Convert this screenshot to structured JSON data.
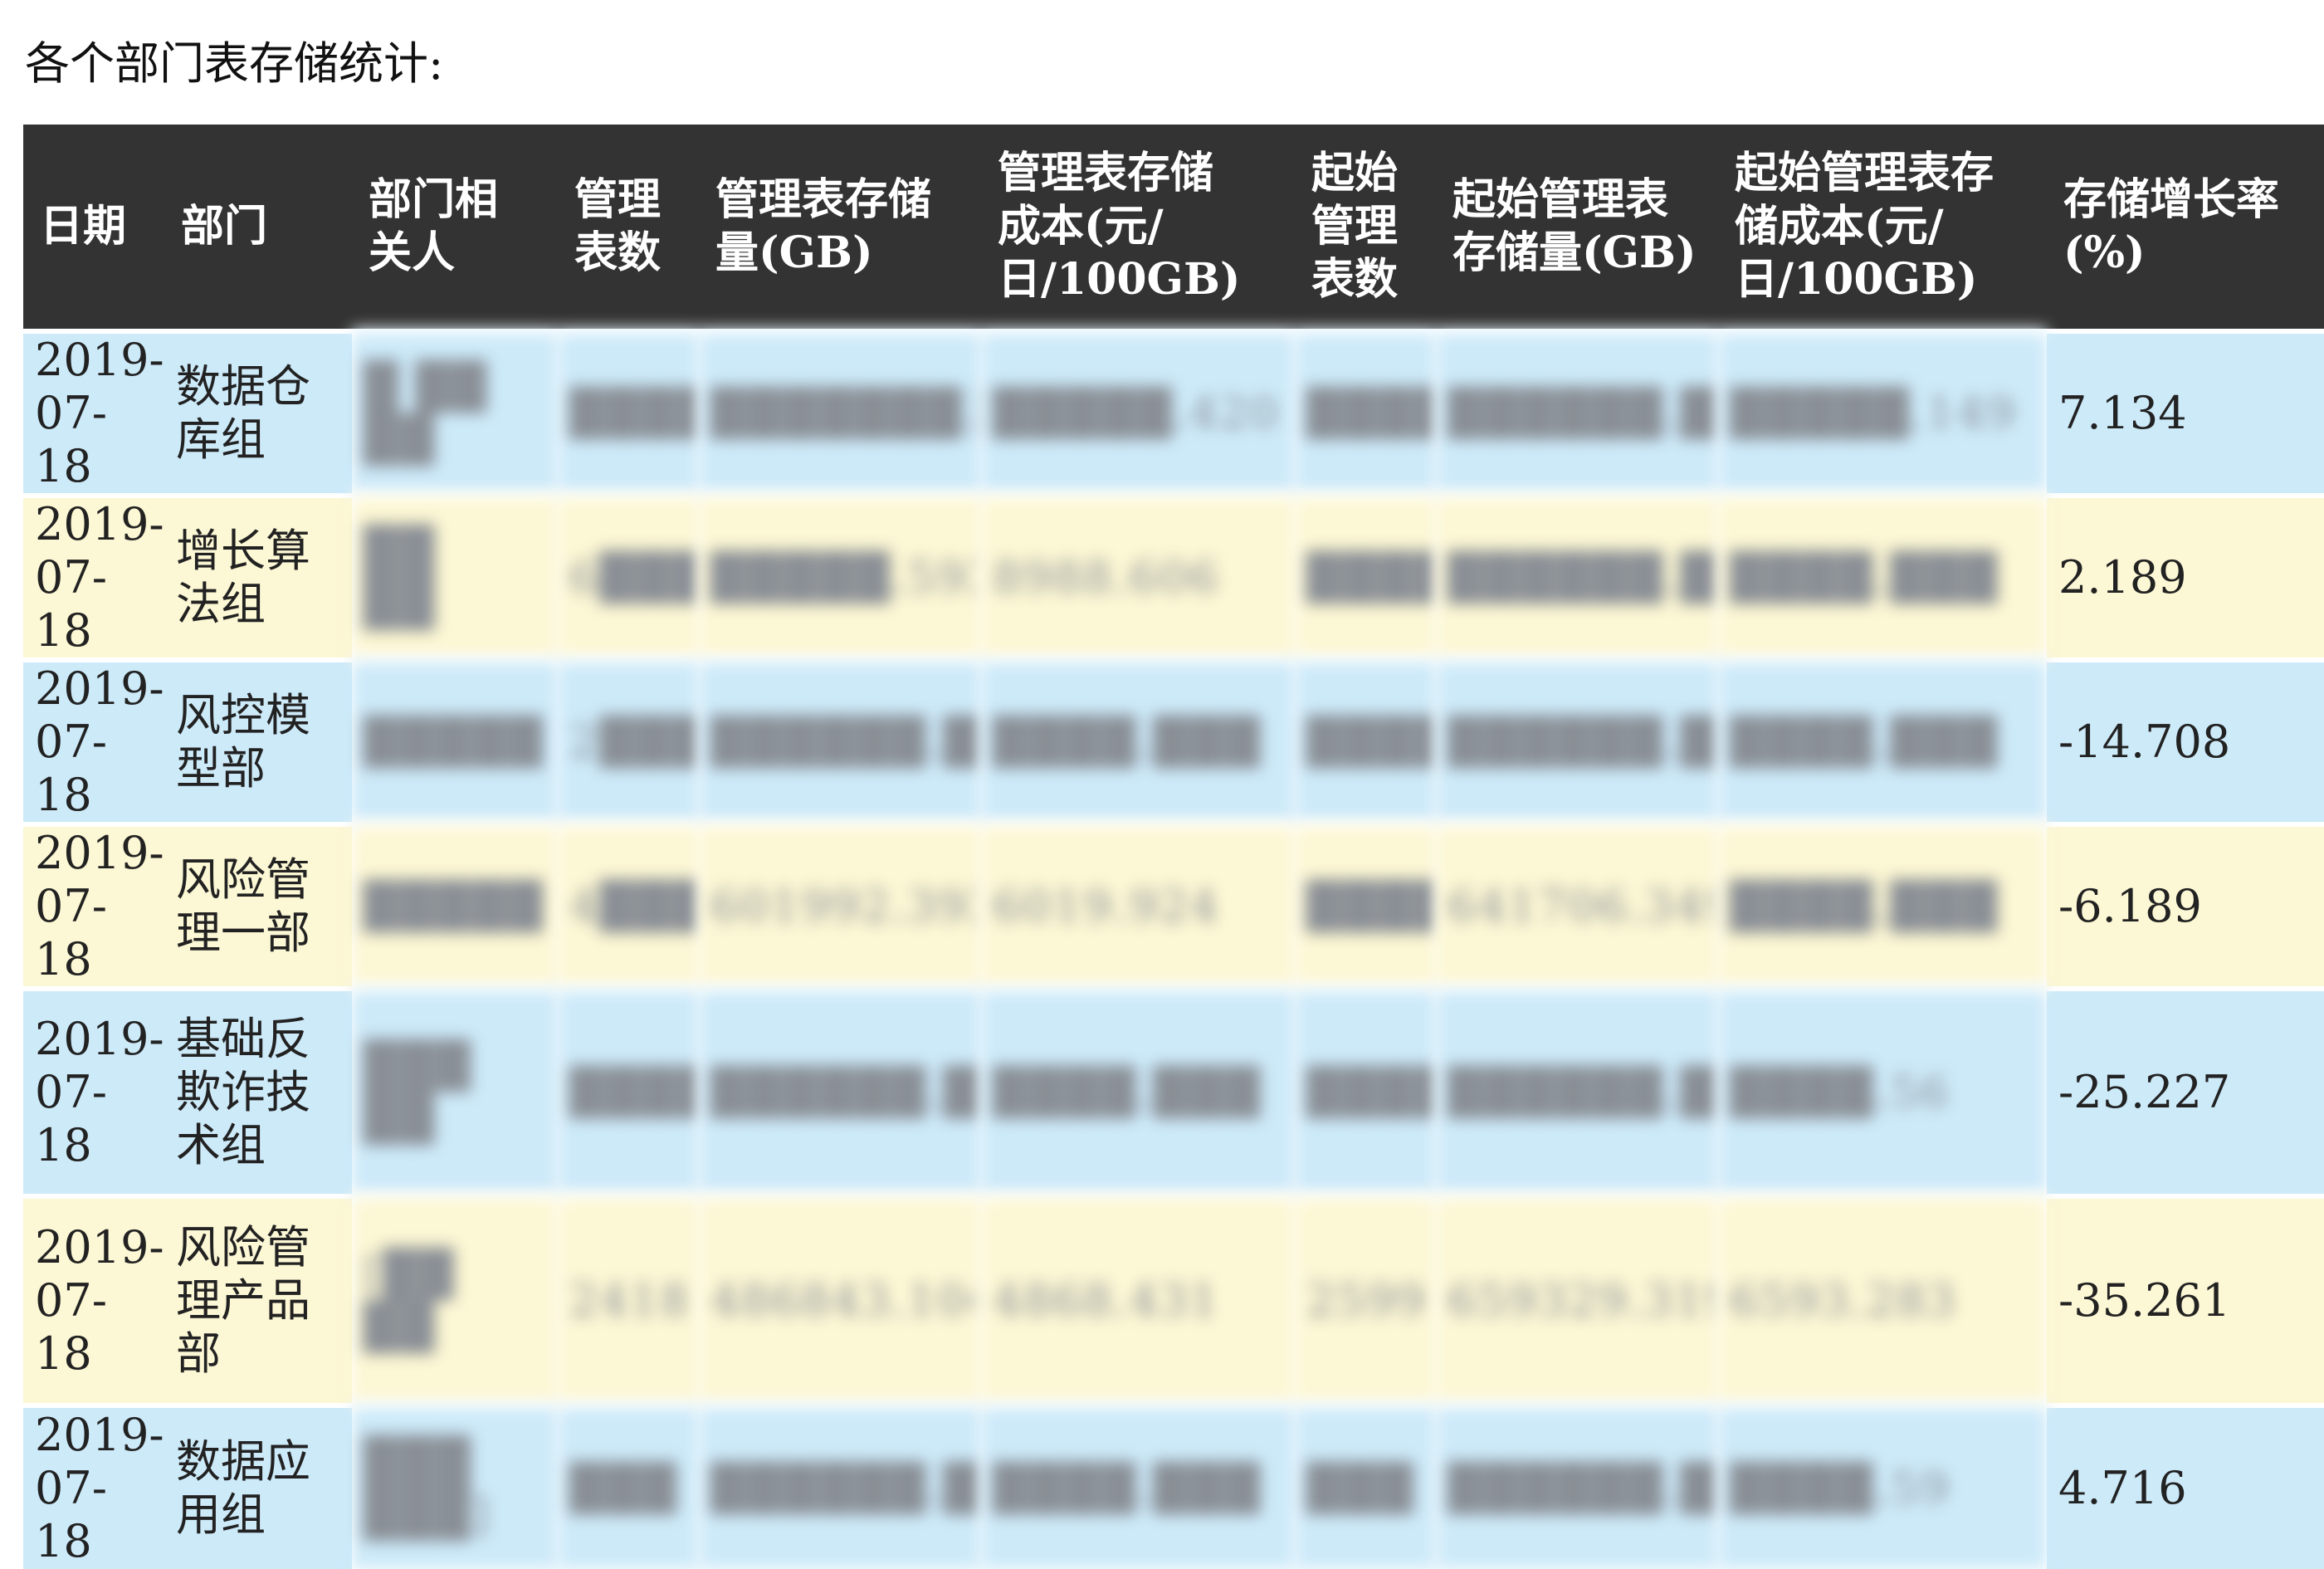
{
  "caption": "各个部门表存储统计:",
  "table": {
    "headers": [
      "日期",
      "部门",
      "部门相\n关人",
      "管理\n表数",
      "管理表存储\n量(GB)",
      "管理表存储\n成本(元/\n日/100GB)",
      "起始\n管理\n表数",
      "起始管理表\n存储量(GB)",
      "起始管理表存\n储成本(元/\n日/100GB)",
      "存储增长率\n(%)"
    ],
    "rows": [
      {
        "date": "2019-\n07-18",
        "dept": "数据仓\n库组",
        "person": "█ ██\n██",
        "tables": "████",
        "storage": "███████.███",
        "cost": "█████.420",
        "start_tables": "████",
        "start_storage": "██████.███",
        "start_cost": "█████.149",
        "growth": "7.134"
      },
      {
        "date": "2019-\n07-18",
        "dept": "增长算\n法组",
        "person": "██\n██",
        "tables": "6███",
        "storage": "█████.593",
        "cost": "8988.606",
        "start_tables": "████",
        "start_storage": "██████.███",
        "start_cost": "████.███",
        "growth": "2.189"
      },
      {
        "date": "2019-\n07-18",
        "dept": "风控模\n型部",
        "person": "█████",
        "tables": "2███",
        "storage": "██████.███",
        "cost": "████.███",
        "start_tables": "████",
        "start_storage": "██████.███",
        "start_cost": "████.███",
        "growth": "-14.708"
      },
      {
        "date": "2019-\n07-18",
        "dept": "风险管\n理一部",
        "person": "█████",
        "tables": "4███",
        "storage": "601992.393",
        "cost": "6019.924",
        "start_tables": "████",
        "start_storage": "641706.349",
        "start_cost": "████.███",
        "growth": "-6.189"
      },
      {
        "date": "2019-\n07-18",
        "dept": "基础反\n欺诈技\n术组",
        "person": "███\n██",
        "tables": "████",
        "storage": "██████.███",
        "cost": "████.███",
        "start_tables": "████",
        "start_storage": "██████.███",
        "start_cost": "████.56",
        "growth": "-25.227"
      },
      {
        "date": "2019-\n07-18",
        "dept": "风险管\n理产品\n部",
        "person": "[██\n██",
        "tables": "2418",
        "storage": "486843.104",
        "cost": "4868.431",
        "start_tables": "2599",
        "start_storage": "659329.319",
        "start_cost": "6593.283",
        "growth": "-35.261"
      },
      {
        "date": "2019-\n07-18",
        "dept": "数据应\n用组",
        "person": "███\n███]",
        "tables": "███",
        "storage": "██████.███",
        "cost": "████.███",
        "start_tables": "███",
        "start_storage": "██████.███",
        "start_cost": "████.59",
        "growth": "4.716"
      }
    ]
  }
}
